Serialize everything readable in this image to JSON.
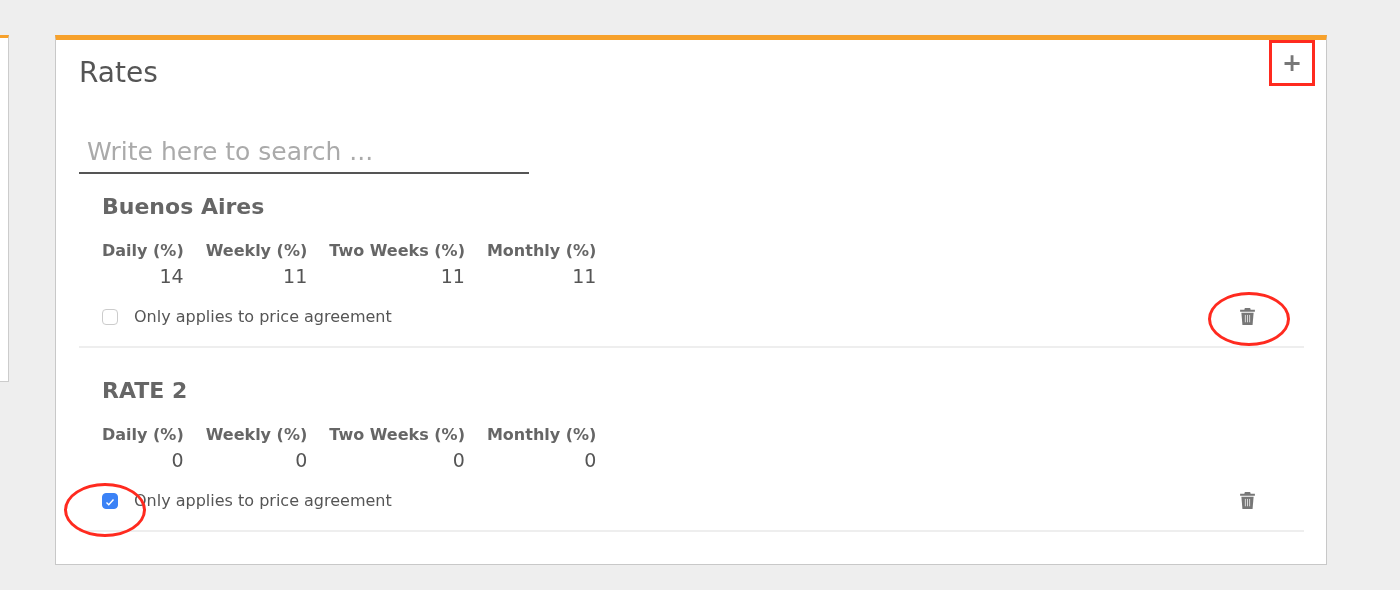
{
  "panel": {
    "title": "Rates",
    "add_button": "+",
    "add_highlighted": true
  },
  "search": {
    "placeholder": "Write here to search ..."
  },
  "rates": [
    {
      "name": "Buenos Aires",
      "columns": [
        {
          "label": "Daily (%)",
          "value": "14"
        },
        {
          "label": "Weekly (%)",
          "value": "11"
        },
        {
          "label": "Two Weeks (%)",
          "value": "11"
        },
        {
          "label": "Monthly (%)",
          "value": "11"
        }
      ],
      "delete_highlighted": true,
      "option": {
        "label": "Only applies to price agreement",
        "checked": false
      }
    },
    {
      "name": "RATE 2",
      "columns": [
        {
          "label": "Daily (%)",
          "value": "0"
        },
        {
          "label": "Weekly (%)",
          "value": "0"
        },
        {
          "label": "Two Weeks (%)",
          "value": "0"
        },
        {
          "label": "Monthly (%)",
          "value": "0"
        }
      ],
      "option": {
        "label": "Only applies to price agreement",
        "checked": true,
        "highlighted": true
      }
    }
  ]
}
